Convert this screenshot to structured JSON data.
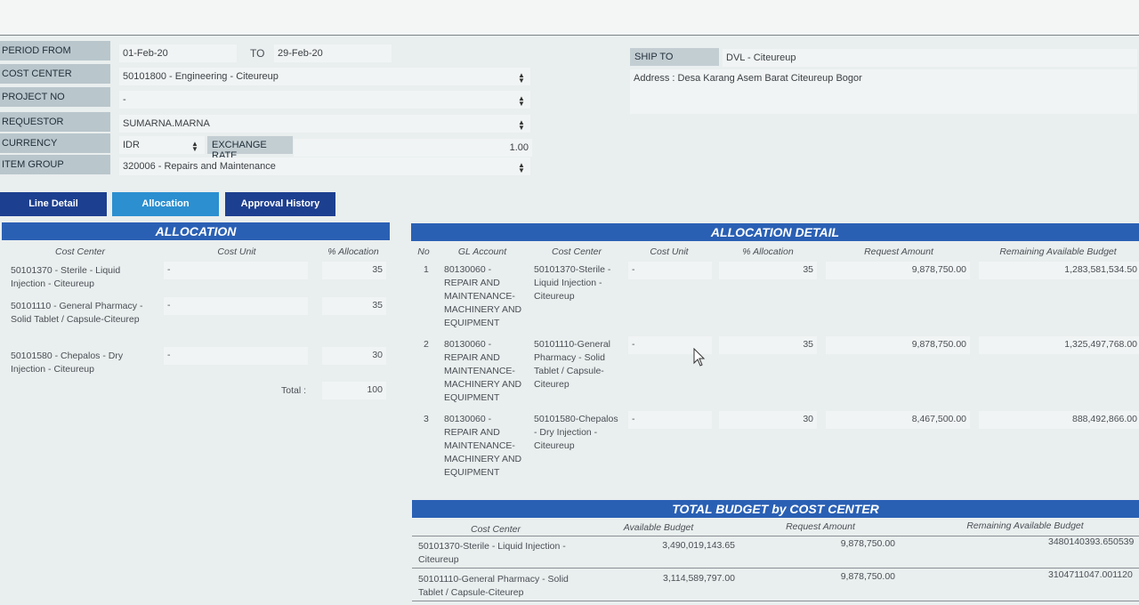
{
  "header": {
    "period_from_label": "PERIOD FROM",
    "period_from": "01-Feb-20",
    "to_label": "TO",
    "period_to": "29-Feb-20",
    "cost_center_label": "COST CENTER",
    "cost_center": "50101800 - Engineering - Citeureup",
    "project_no_label": "PROJECT NO",
    "project_no": "-",
    "requestor_label": "REQUESTOR",
    "requestor": "SUMARNA.MARNA",
    "currency_label": "CURRENCY",
    "currency": "IDR",
    "exchange_rate_label": "EXCHANGE RATE",
    "exchange_rate": "1.00",
    "item_group_label": "ITEM GROUP",
    "item_group": "320006 - Repairs and Maintenance",
    "ship_to_label": "SHIP TO",
    "ship_to": "DVL - Citeureup",
    "address": "Address : Desa Karang Asem Barat Citeureup Bogor"
  },
  "tabs": [
    {
      "label": "Line Detail",
      "active": false
    },
    {
      "label": "Allocation",
      "active": true
    },
    {
      "label": "Approval History",
      "active": false
    }
  ],
  "allocation": {
    "title": "ALLOCATION",
    "columns": [
      "Cost Center",
      "Cost Unit",
      "% Allocation"
    ],
    "rows": [
      {
        "cost_center": "50101370 - Sterile - Liquid Injection - Citeureup",
        "cost_unit": "-",
        "pct": "35"
      },
      {
        "cost_center": "50101110 - General Pharmacy - Solid Tablet / Capsule-Citeurep",
        "cost_unit": "-",
        "pct": "35"
      },
      {
        "cost_center": "50101580 - Chepalos - Dry Injection - Citeureup",
        "cost_unit": "-",
        "pct": "30"
      }
    ],
    "total_label": "Total :",
    "total": "100"
  },
  "allocation_detail": {
    "title": "ALLOCATION DETAIL",
    "columns": [
      "No",
      "GL Account",
      "Cost Center",
      "Cost Unit",
      "% Allocation",
      "Request Amount",
      "Remaining Available Budget"
    ],
    "rows": [
      {
        "no": "1",
        "gl": "80130060 - REPAIR AND MAINTENANCE-MACHINERY AND EQUIPMENT",
        "cc": "50101370-Sterile - Liquid Injection - Citeureup",
        "unit": "-",
        "pct": "35",
        "amount": "9,878,750.00",
        "remaining": "1,283,581,534.50"
      },
      {
        "no": "2",
        "gl": "80130060 - REPAIR AND MAINTENANCE-MACHINERY AND EQUIPMENT",
        "cc": "50101110-General Pharmacy - Solid Tablet / Capsule-Citeurep",
        "unit": "-",
        "pct": "35",
        "amount": "9,878,750.00",
        "remaining": "1,325,497,768.00"
      },
      {
        "no": "3",
        "gl": "80130060 - REPAIR AND MAINTENANCE-MACHINERY AND EQUIPMENT",
        "cc": "50101580-Chepalos - Dry Injection - Citeureup",
        "unit": "-",
        "pct": "30",
        "amount": "8,467,500.00",
        "remaining": "888,492,866.00"
      }
    ]
  },
  "total_budget": {
    "title": "TOTAL BUDGET by COST CENTER",
    "columns": [
      "Cost Center",
      "Available Budget",
      "Request Amount",
      "Remaining Available Budget"
    ],
    "rows": [
      {
        "cc": "50101370-Sterile - Liquid Injection - Citeureup",
        "available": "3,490,019,143.65",
        "request": "9,878,750.00",
        "remaining": "3480140393.650539"
      },
      {
        "cc": "50101110-General Pharmacy - Solid Tablet / Capsule-Citeurep",
        "available": "3,114,589,797.00",
        "request": "9,878,750.00",
        "remaining": "3104711047.001120"
      }
    ]
  },
  "colors": {
    "accent": "#2a60b4",
    "tab_active": "#2b8fd0",
    "tab_inactive": "#1d3f8f"
  }
}
